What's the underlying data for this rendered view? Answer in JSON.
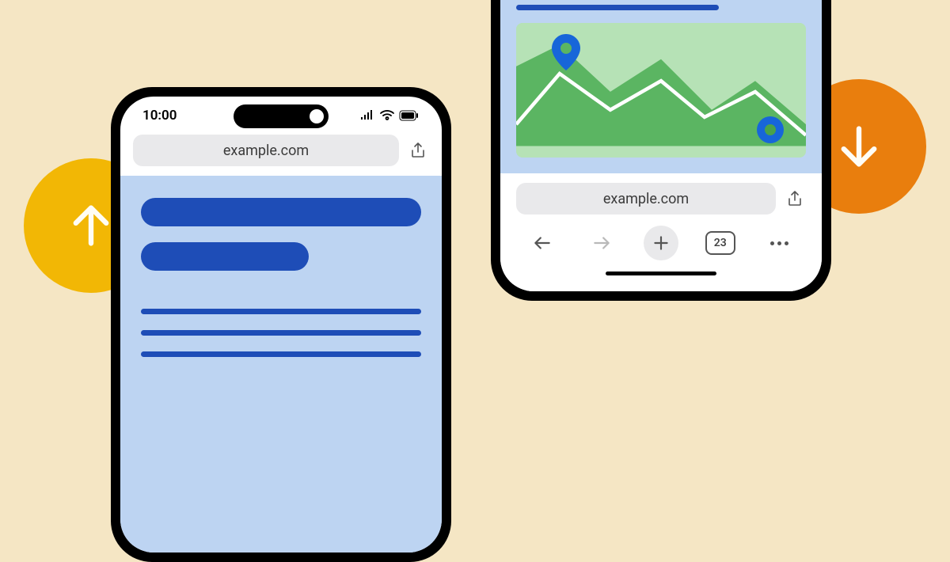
{
  "badges": {
    "left_icon": "arrow-up",
    "right_icon": "arrow-down"
  },
  "phone_left": {
    "status": {
      "time": "10:00"
    },
    "address_bar": {
      "url": "example.com"
    }
  },
  "phone_right": {
    "address_bar": {
      "url": "example.com"
    },
    "toolbar": {
      "tab_count": "23"
    }
  }
}
